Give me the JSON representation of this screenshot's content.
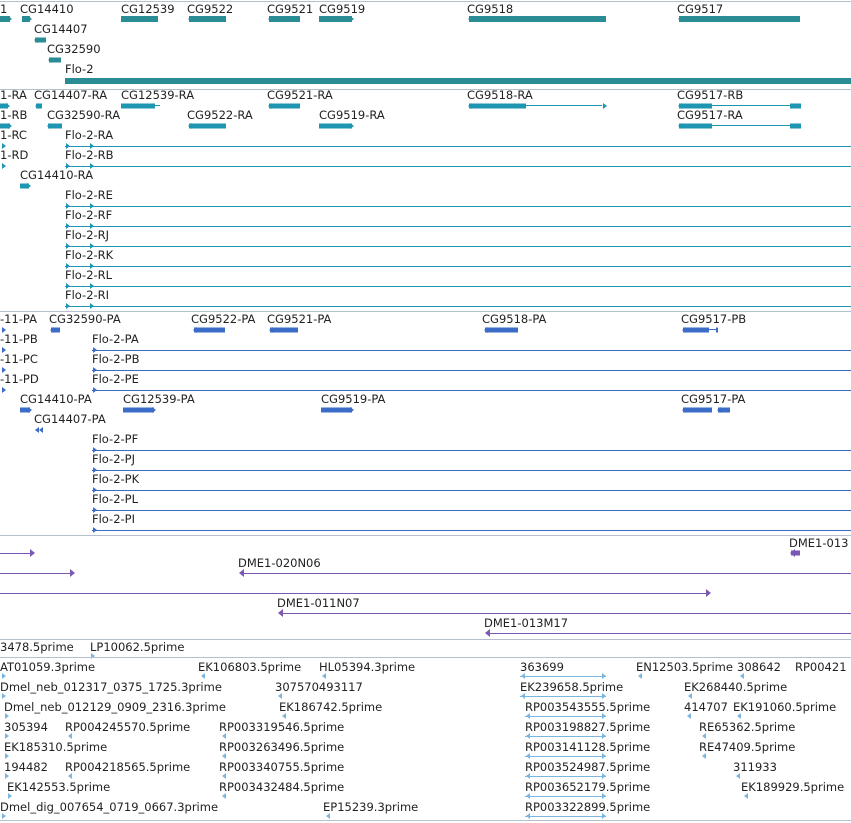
{
  "colors": {
    "gene": "#2a8c94",
    "transcript": "#1e96b2",
    "protein": "#3a6cc8",
    "clone": "#7a58b4",
    "est": "#7ab6e0",
    "separator": "#b4c0cc"
  },
  "genes": {
    "labels": [
      "1",
      "CG14410",
      "CG12539",
      "CG9522",
      "CG9521",
      "CG9519",
      "CG9518",
      "CG9517",
      "CG14407",
      "CG32590",
      "Flo-2"
    ]
  },
  "transcripts": {
    "labels": [
      "1-RA",
      "CG14407-RA",
      "CG12539-RA",
      "CG9521-RA",
      "CG9518-RA",
      "CG9517-RB",
      "1-RB",
      "CG32590-RA",
      "CG9522-RA",
      "CG9519-RA",
      "CG9517-RA",
      "1-RC",
      "Flo-2-RA",
      "1-RD",
      "Flo-2-RB",
      "CG14410-RA",
      "Flo-2-RE",
      "Flo-2-RF",
      "Flo-2-RJ",
      "Flo-2-RK",
      "Flo-2-RL",
      "Flo-2-RI"
    ]
  },
  "proteins": {
    "labels": [
      "-11-PA",
      "CG32590-PA",
      "CG9522-PA",
      "CG9521-PA",
      "CG9518-PA",
      "CG9517-PB",
      "-11-PB",
      "Flo-2-PA",
      "-11-PC",
      "Flo-2-PB",
      "-11-PD",
      "Flo-2-PE",
      "CG14410-PA",
      "CG12539-PA",
      "CG9519-PA",
      "CG9517-PA",
      "CG14407-PA",
      "Flo-2-PF",
      "Flo-2-PJ",
      "Flo-2-PK",
      "Flo-2-PL",
      "Flo-2-PI"
    ]
  },
  "clones": {
    "labels": [
      "DME1-013",
      "DME1-020N06",
      "DME1-011N07",
      "DME1-013M17"
    ]
  },
  "ests": {
    "labels": [
      "3478.5prime",
      "LP10062.5prime",
      "AT01059.3prime",
      "EK106803.5prime",
      "HL05394.3prime",
      "363699",
      "EN12503.5prime",
      "308642",
      "RP00421",
      "Dmel_neb_012317_0375_1725.3prime",
      "307570493117",
      "EK239658.5prime",
      "EK268440.5prime",
      "Dmel_neb_012129_0909_2316.3prime",
      "EK186742.5prime",
      "RP003543555.5prime",
      "414707",
      "EK191060.5prime",
      "305394",
      "RP004245570.5prime",
      "RP003319546.5prime",
      "RP003198827.5prime",
      "RE65362.5prime",
      "EK185310.5prime",
      "RP003263496.5prime",
      "RP003141128.5prime",
      "RE47409.5prime",
      "194482",
      "RP004218565.5prime",
      "RP003340755.5prime",
      "RP003524987.5prime",
      "311933",
      "EK142553.5prime",
      "RP003432484.5prime",
      "RP003652179.5prime",
      "EK189929.5prime",
      "Dmel_dig_007654_0719_0667.3prime",
      "EP15239.3prime",
      "RP003322899.5prime"
    ]
  }
}
